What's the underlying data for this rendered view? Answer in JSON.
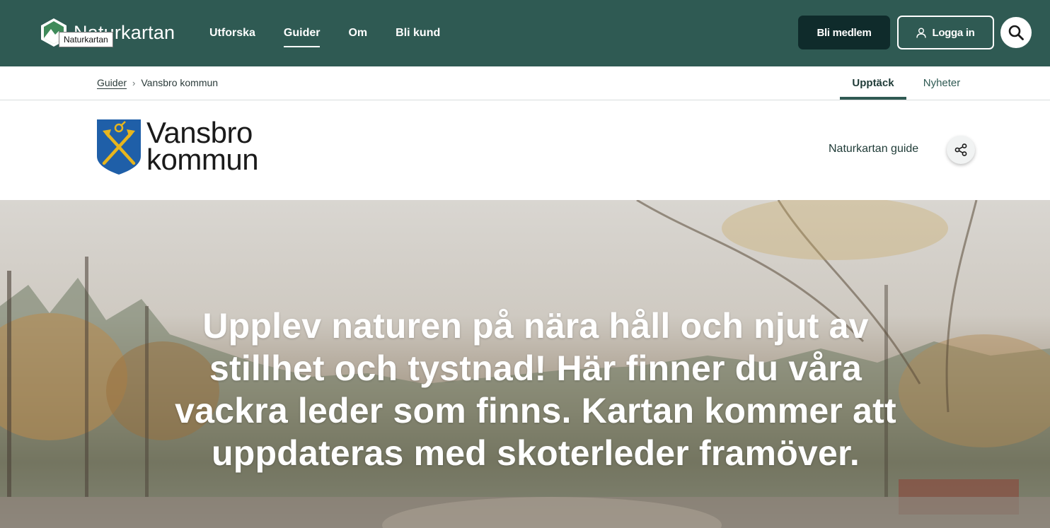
{
  "header": {
    "brand_name": "Naturkartan",
    "tooltip": "Naturkartan",
    "nav": [
      {
        "label": "Utforska",
        "active": false
      },
      {
        "label": "Guider",
        "active": true
      },
      {
        "label": "Om",
        "active": false
      },
      {
        "label": "Bli kund",
        "active": false
      }
    ],
    "member_button": "Bli medlem",
    "login_button": "Logga in",
    "icons": {
      "search": "search-icon",
      "user": "user-icon",
      "logo": "naturkartan-logo-icon"
    }
  },
  "subnav": {
    "breadcrumb": {
      "parent": "Guider",
      "separator": "›",
      "current": "Vansbro kommun"
    },
    "tabs": [
      {
        "label": "Upptäck",
        "active": true
      },
      {
        "label": "Nyheter",
        "active": false
      }
    ]
  },
  "org": {
    "name_line1": "Vansbro",
    "name_line2": "kommun",
    "guide_label": "Naturkartan guide",
    "share_icon": "share-icon"
  },
  "hero": {
    "title": "Upplev naturen på nära håll och njut av stillhet och tystnad! Här finner du våra vackra leder som finns. Kartan kommer att uppdateras med skoterleder framöver."
  },
  "colors": {
    "header_bg": "#2f5a53",
    "member_button_bg": "#0f2b2b",
    "accent": "#2f5a53",
    "shield_blue": "#1f5fa8",
    "shield_gold": "#e7b51d"
  }
}
